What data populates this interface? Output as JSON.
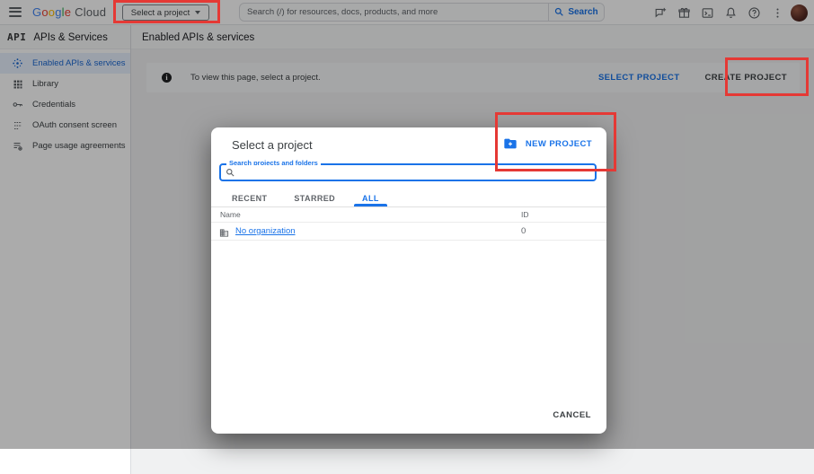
{
  "topbar": {
    "logo": {
      "brand": "Google",
      "suffix": "Cloud",
      "letter_colors": [
        "#4285F4",
        "#EA4335",
        "#FBBC04",
        "#4285F4",
        "#34A853",
        "#EA4335"
      ]
    },
    "project_picker": {
      "label": "Select a project"
    },
    "search": {
      "placeholder": "Search (/) for resources, docs, products, and more",
      "button_label": "Search"
    },
    "icons": [
      "feedback-icon",
      "gift-icon",
      "cloud-shell-icon",
      "notifications-icon",
      "help-icon",
      "more-vert-icon"
    ]
  },
  "subheader": {
    "product_glyph": "API",
    "product_name": "APIs & Services",
    "page_title": "Enabled APIs & services"
  },
  "sidebar": {
    "items": [
      {
        "label": "Enabled APIs & services",
        "icon": "enabled-apis-icon",
        "selected": true
      },
      {
        "label": "Library",
        "icon": "library-icon",
        "selected": false
      },
      {
        "label": "Credentials",
        "icon": "key-icon",
        "selected": false
      },
      {
        "label": "OAuth consent screen",
        "icon": "oauth-icon",
        "selected": false
      },
      {
        "label": "Page usage agreements",
        "icon": "agreements-icon",
        "selected": false
      }
    ]
  },
  "banner": {
    "message": "To view this page, select a project.",
    "select_label": "SELECT PROJECT",
    "create_label": "CREATE PROJECT"
  },
  "modal": {
    "title": "Select a project",
    "new_project_label": "NEW PROJECT",
    "search_label": "Search projects and folders",
    "tabs": [
      "RECENT",
      "STARRED",
      "ALL"
    ],
    "active_tab": "ALL",
    "table": {
      "columns": [
        "Name",
        "ID"
      ],
      "rows": [
        {
          "name": "No organization",
          "id": "0"
        }
      ]
    },
    "cancel_label": "CANCEL"
  },
  "colors": {
    "accent_blue": "#1a73e8",
    "selected_nav_blue": "#1967d2",
    "annotation_red": "#e53935",
    "scrim": "rgba(0,0,0,0.33)"
  }
}
